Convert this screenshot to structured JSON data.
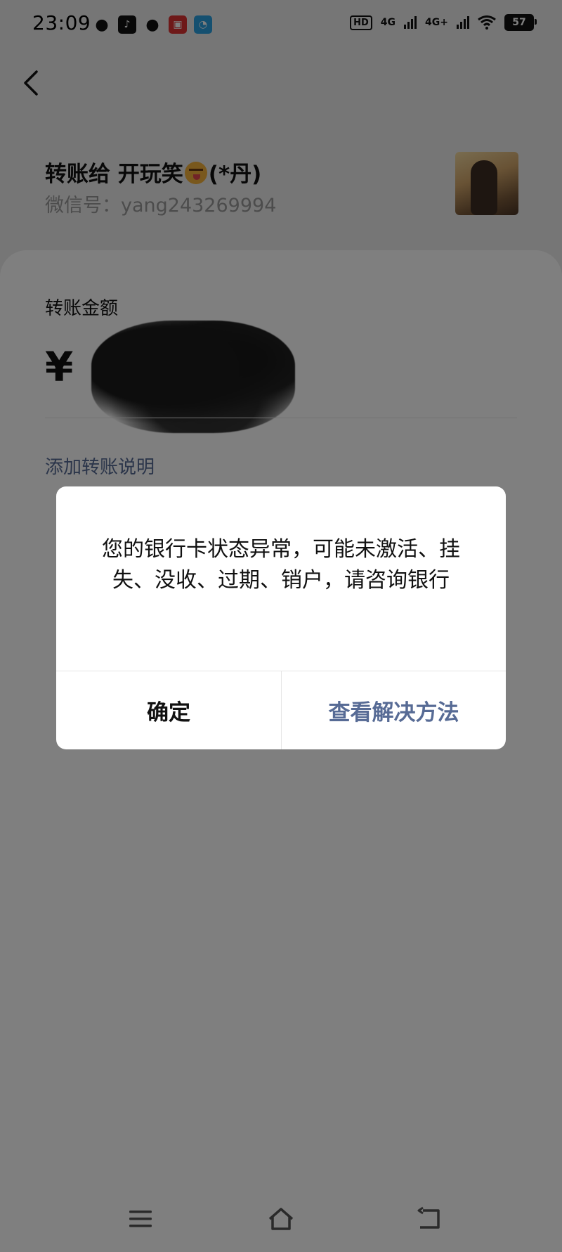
{
  "status_bar": {
    "time": "23:09",
    "hd_label": "HD",
    "net1": "4G",
    "net2": "4G+",
    "battery": "57"
  },
  "header": {
    "recipient_prefix": "转账给 开玩笑",
    "recipient_suffix": "(*丹)",
    "wechat_id": "微信号：yang243269994"
  },
  "amount": {
    "label": "转账金额",
    "currency": "¥"
  },
  "add_note": "添加转账说明",
  "dialog": {
    "message": "您的银行卡状态异常，可能未激活、挂失、没收、过期、销户，请咨询银行",
    "ok": "确定",
    "solution": "查看解决方法"
  },
  "colors": {
    "link": "#576b95",
    "overlay": "rgba(0,0,0,0.5)"
  },
  "icons": {
    "back": "back-arrow-icon",
    "menu": "menu-icon",
    "home": "home-icon",
    "nav_back": "nav-back-icon"
  }
}
